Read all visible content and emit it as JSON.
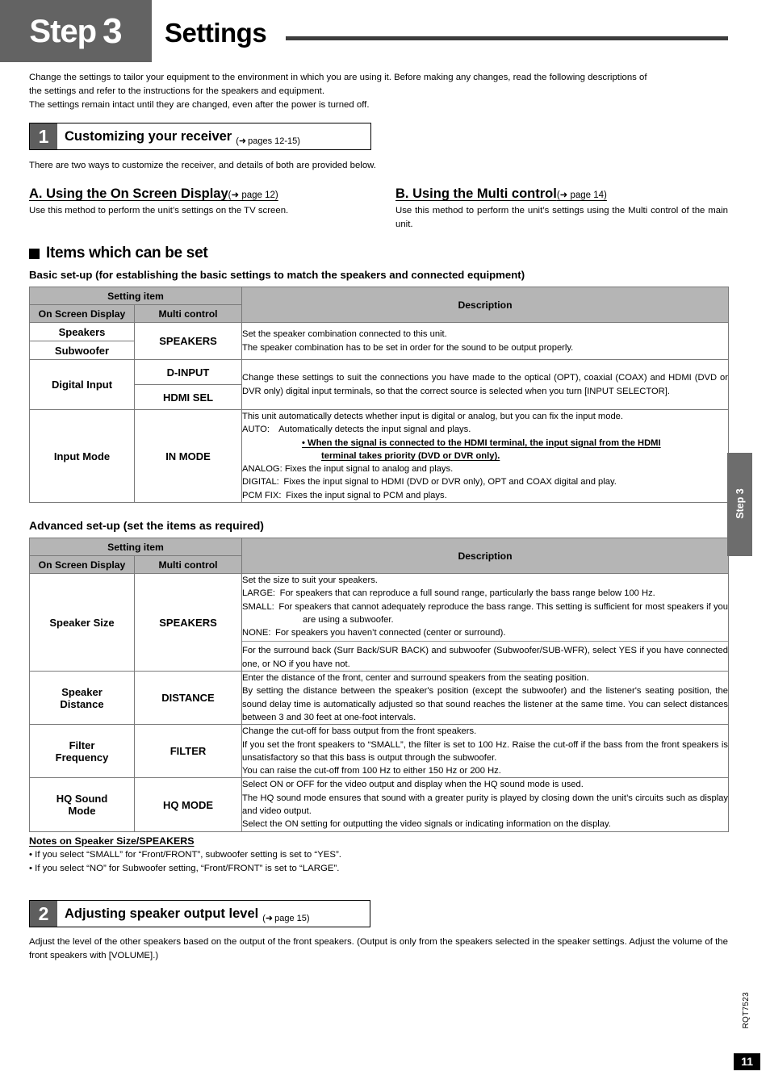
{
  "header": {
    "step_word": "Step",
    "step_number": "3",
    "title": "Settings"
  },
  "intro": {
    "line1": "Change the settings to tailor your equipment to the environment in which you are using it. Before making any changes, read the following descriptions of",
    "line2": "the settings and refer to the instructions for the speakers and equipment.",
    "line3": "The settings remain intact until they are changed, even after the power is turned off."
  },
  "section1": {
    "number": "1",
    "label": "Customizing your receiver",
    "reference": "(➜ pages 12-15)",
    "arrow": "➜",
    "ref_text": "pages 12-15",
    "intro": "There are two ways to customize the receiver, and details of both are provided below.",
    "method_a": {
      "title": "A. Using the On Screen Display",
      "ref": "(➜ page 12)",
      "body": "Use this method to perform the unit’s settings on the TV screen."
    },
    "method_b": {
      "title": "B. Using the Multi control",
      "ref": "(➜ page 14)",
      "body_line1": "Use this method to perform the unit’s settings using the Multi control of the",
      "body_line2": "main unit."
    }
  },
  "items_section": {
    "heading": "Items which can be set",
    "basic_caption": "Basic set-up (for establishing the basic settings to match the speakers and connected equipment)",
    "advanced_caption": "Advanced set-up (set the items as required)"
  },
  "table_headers": {
    "setting_item": "Setting item",
    "description": "Description",
    "on_screen_display": "On Screen Display",
    "multi_control": "Multi control"
  },
  "basic_table": {
    "rows": [
      {
        "osd": [
          "Speakers",
          "Subwoofer"
        ],
        "multi": "SPEAKERS",
        "desc": [
          "Set the speaker combination connected to this unit.",
          "The speaker combination has to be set in order for the sound to be output properly."
        ]
      },
      {
        "osd": "Digital Input",
        "multi": [
          "D-INPUT",
          "HDMI SEL"
        ],
        "desc": [
          "Change these settings to suit the connections you have made to the optical (OPT), coaxial (COAX) and HDMI (DVD or DVR only) digital input terminals, so that the correct source is selected when you turn [INPUT SELECTOR]."
        ]
      },
      {
        "osd": "Input Mode",
        "multi": "IN MODE",
        "desc_line1": "This unit automatically detects whether input is digital or analog, but you can fix the input mode.",
        "desc_auto": "AUTO: Automatically detects the input signal and plays.",
        "desc_bullet_l1": "• When the signal is connected to the HDMI terminal, the input signal from the HDMI",
        "desc_bullet_l2": "terminal takes priority (DVD or DVR only).",
        "desc_analog": "ANALOG: Fixes the input signal to analog and plays.",
        "desc_digital": "DIGITAL: Fixes the input signal to HDMI (DVD or DVR only), OPT and COAX digital and play.",
        "desc_pcm": "PCM FIX: Fixes the input signal to PCM and plays."
      }
    ]
  },
  "advanced_table": {
    "rows": [
      {
        "osd": "Speaker Size",
        "multi": "SPEAKERS",
        "d1": "Set the size to suit your speakers.",
        "d2": "LARGE: For speakers that can reproduce a full sound range, particularly the bass range below 100 Hz.",
        "d3": "SMALL: For speakers that cannot adequately reproduce the bass range. This setting is sufficient for most speakers if you are using a subwoofer.",
        "d4": "NONE: For speakers you haven’t connected (center or surround).",
        "d5": "For the surround back (Surr Back/SUR BACK) and subwoofer (Subwoofer/SUB-WFR), select YES if you have connected one, or NO if you have not."
      },
      {
        "osd_line1": "Speaker",
        "osd_line2": "Distance",
        "multi": "DISTANCE",
        "d1": "Enter the distance of the front, center and surround speakers from the seating position.",
        "d2": "By setting the distance between the speaker's position (except the subwoofer) and the listener's seating position, the sound delay time is automatically adjusted so that sound reaches the listener at the same time.  You can select distances between 3 and 30 feet at one-foot intervals."
      },
      {
        "osd_line1": "Filter",
        "osd_line2": "Frequency",
        "multi": "FILTER",
        "d1": "Change the cut-off for bass output from the front speakers.",
        "d2": "If you set the front speakers to “SMALL”, the filter is set to 100 Hz. Raise the cut-off if the bass from the front speakers is unsatisfactory so that this bass is output through the subwoofer.",
        "d3": "You can raise the cut-off from 100 Hz to either 150 Hz or 200 Hz."
      },
      {
        "osd_line1": "HQ Sound",
        "osd_line2": "Mode",
        "multi": "HQ MODE",
        "d1": "Select ON or OFF for the video output and display when the HQ sound mode is used.",
        "d2": "The HQ sound mode ensures that sound with a greater purity is played by closing down the unit’s circuits such as display and video output.",
        "d3": "Select the ON setting for outputting the video signals or indicating information on the display."
      }
    ]
  },
  "notes": {
    "heading": "Notes on Speaker Size/SPEAKERS",
    "item1": "• If you select “SMALL” for “Front/FRONT”, subwoofer setting is set to “YES”.",
    "item2": "• If you select “NO” for Subwoofer setting, “Front/FRONT” is set to “LARGE”."
  },
  "section2": {
    "number": "2",
    "label": "Adjusting speaker output level",
    "arrow": "➜",
    "ref_text": "page 15",
    "body_line1": "Adjust the level of the other speakers based on the output of the front speakers. (Output is only from the speakers selected in the speaker settings.",
    "body_line2": "Adjust the volume of the front speakers with [VOLUME].)"
  },
  "side_tab": {
    "label": "Step 3"
  },
  "footer": {
    "doc_code": "RQT7523",
    "page_number": "11"
  },
  "colors": {
    "badge_gray": "#636363",
    "table_header_gray": "#b5b5b5",
    "side_tab_gray": "#6d6d6d",
    "rule_gray": "#3d3d3d"
  }
}
